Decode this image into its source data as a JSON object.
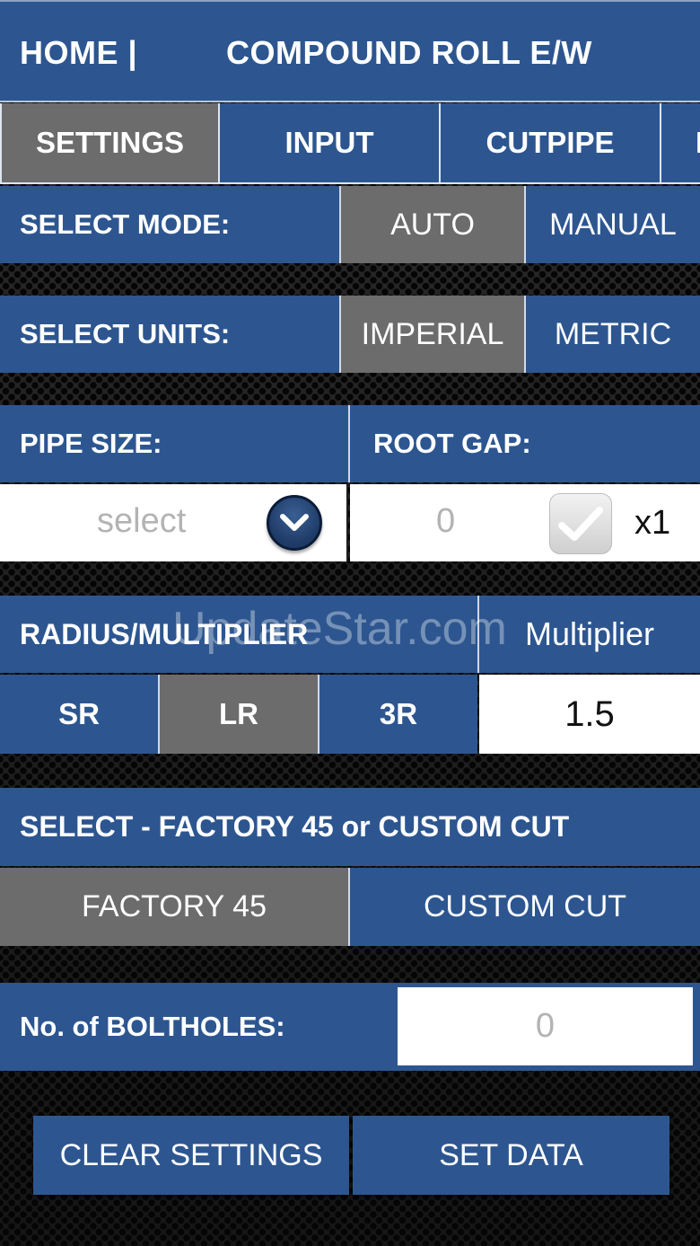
{
  "header": {
    "home": "HOME  |",
    "title": "COMPOUND ROLL E/W"
  },
  "tabs": [
    {
      "label": "SETTINGS",
      "active": true
    },
    {
      "label": "INPUT",
      "active": false
    },
    {
      "label": "CUTPIPE",
      "active": false
    },
    {
      "label": "I",
      "active": false
    }
  ],
  "mode": {
    "label": "SELECT MODE:",
    "options": [
      "AUTO",
      "MANUAL"
    ],
    "selected": "AUTO"
  },
  "units": {
    "label": "SELECT UNITS:",
    "options": [
      "IMPERIAL",
      "METRIC"
    ],
    "selected": "IMPERIAL"
  },
  "pipe_size": {
    "label": "PIPE SIZE:",
    "placeholder": "select",
    "icon": "chevron-down-icon"
  },
  "root_gap": {
    "label": "ROOT GAP:",
    "placeholder": "0",
    "multiplier_label": "x1",
    "checked": true
  },
  "radius": {
    "label": "RADIUS/MULTIPLIER",
    "multiplier_label": "Multiplier",
    "options": [
      "SR",
      "LR",
      "3R"
    ],
    "selected": "LR",
    "multiplier_value": "1.5"
  },
  "cut": {
    "label": "SELECT - FACTORY 45 or CUSTOM CUT",
    "options": [
      "FACTORY 45",
      "CUSTOM CUT"
    ],
    "selected": "FACTORY 45"
  },
  "boltholes": {
    "label": "No. of BOLTHOLES:",
    "placeholder": "0"
  },
  "actions": {
    "clear": "CLEAR SETTINGS",
    "set": "SET DATA"
  },
  "watermark": "UpdateStar.com",
  "colors": {
    "panel_blue": "#2d5690",
    "selected_gray": "#6c6c6c",
    "placeholder_gray": "#b3b3b3"
  }
}
